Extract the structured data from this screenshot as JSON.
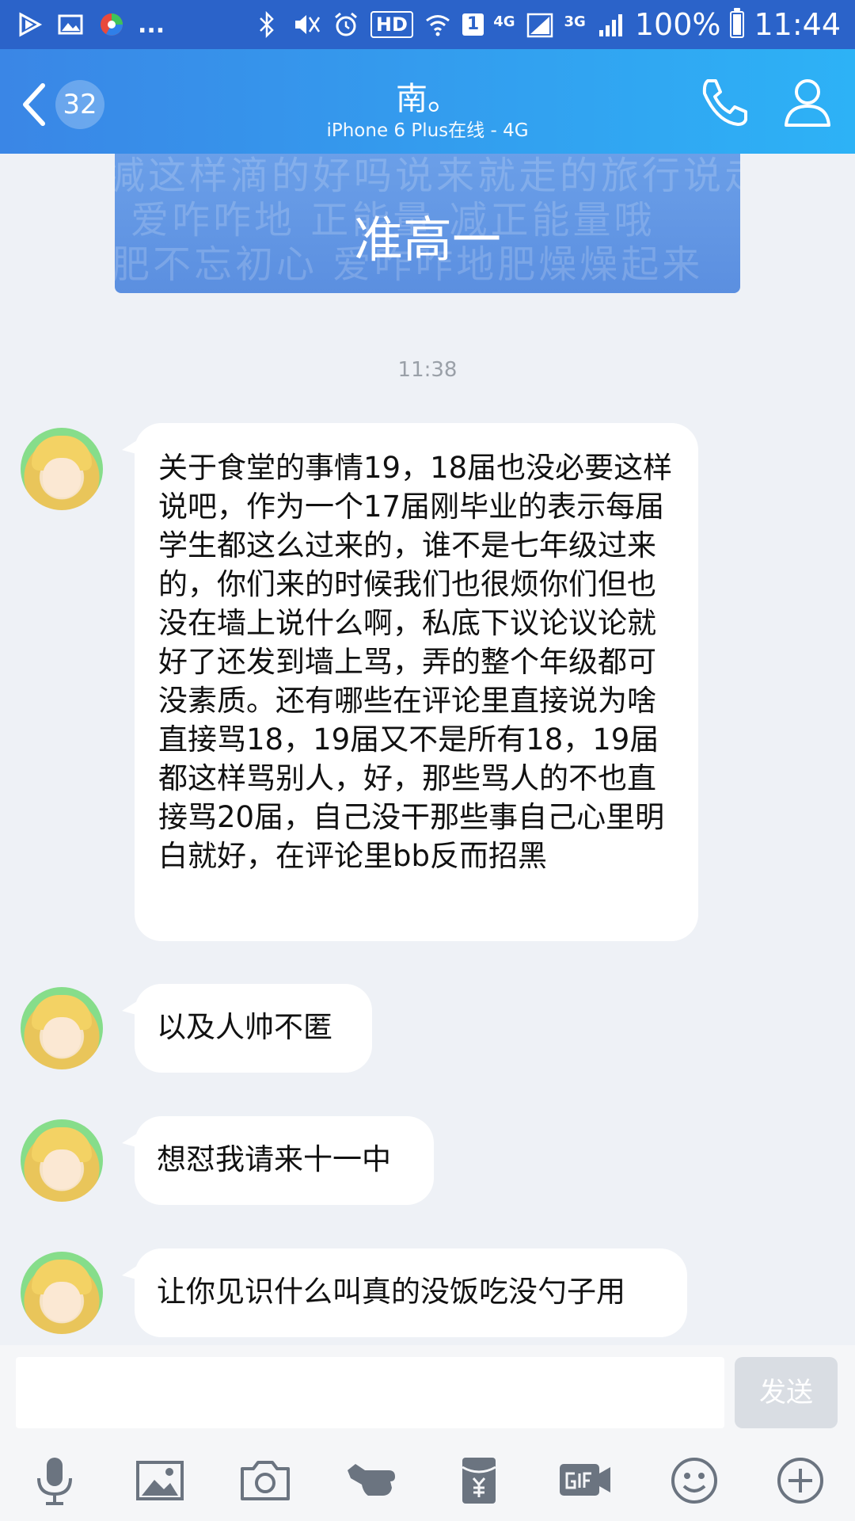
{
  "status_bar": {
    "left_icons": [
      "play-store-icon",
      "gallery-icon",
      "browser-icon"
    ],
    "more": "...",
    "hd": "HD",
    "sim_slot": "1",
    "net1": "4G",
    "net2": "3G",
    "battery": "100%",
    "time": "11:44"
  },
  "header": {
    "unread_count": "32",
    "contact_name": "南。",
    "status": "iPhone 6 Plus在线 - 4G"
  },
  "banner": {
    "title": "准高一",
    "background_text": [
      "减这样滴的好吗说来就走的旅行说走就走",
      "爱咋咋地 正能量 减正能量哦",
      "肥不忘初心 爱咋咋地肥燥燥起来"
    ]
  },
  "time_separator": "11:38",
  "messages": [
    {
      "text": "关于食堂的事情19，18届也没必要这样说吧，作为一个17届刚毕业的表示每届学生都这么过来的，谁不是七年级过来的，你们来的时候我们也很烦你们但也没在墙上说什么啊，私底下议论议论就好了还发到墙上骂，弄的整个年级都可没素质。还有哪些在评论里直接说为啥直接骂18，19届又不是所有18，19届都这样骂别人，好，那些骂人的不也直接骂20届，自己没干那些事自己心里明白就好，在评论里bb反而招黑"
    },
    {
      "text": "以及人帅不匿"
    },
    {
      "text": "想怼我请来十一中"
    },
    {
      "text": "让你见识什么叫真的没饭吃没勺子用"
    }
  ],
  "input": {
    "value": "",
    "send_label": "发送"
  },
  "toolbar": [
    "microphone-icon",
    "image-icon",
    "camera-icon",
    "poke-icon",
    "red-packet-icon",
    "gif-icon",
    "emoji-icon",
    "plus-icon"
  ],
  "colors": {
    "header_start": "#3a86e6",
    "header_end": "#2db2f6",
    "background": "#eef1f6",
    "status_bar": "#2b63c9"
  }
}
